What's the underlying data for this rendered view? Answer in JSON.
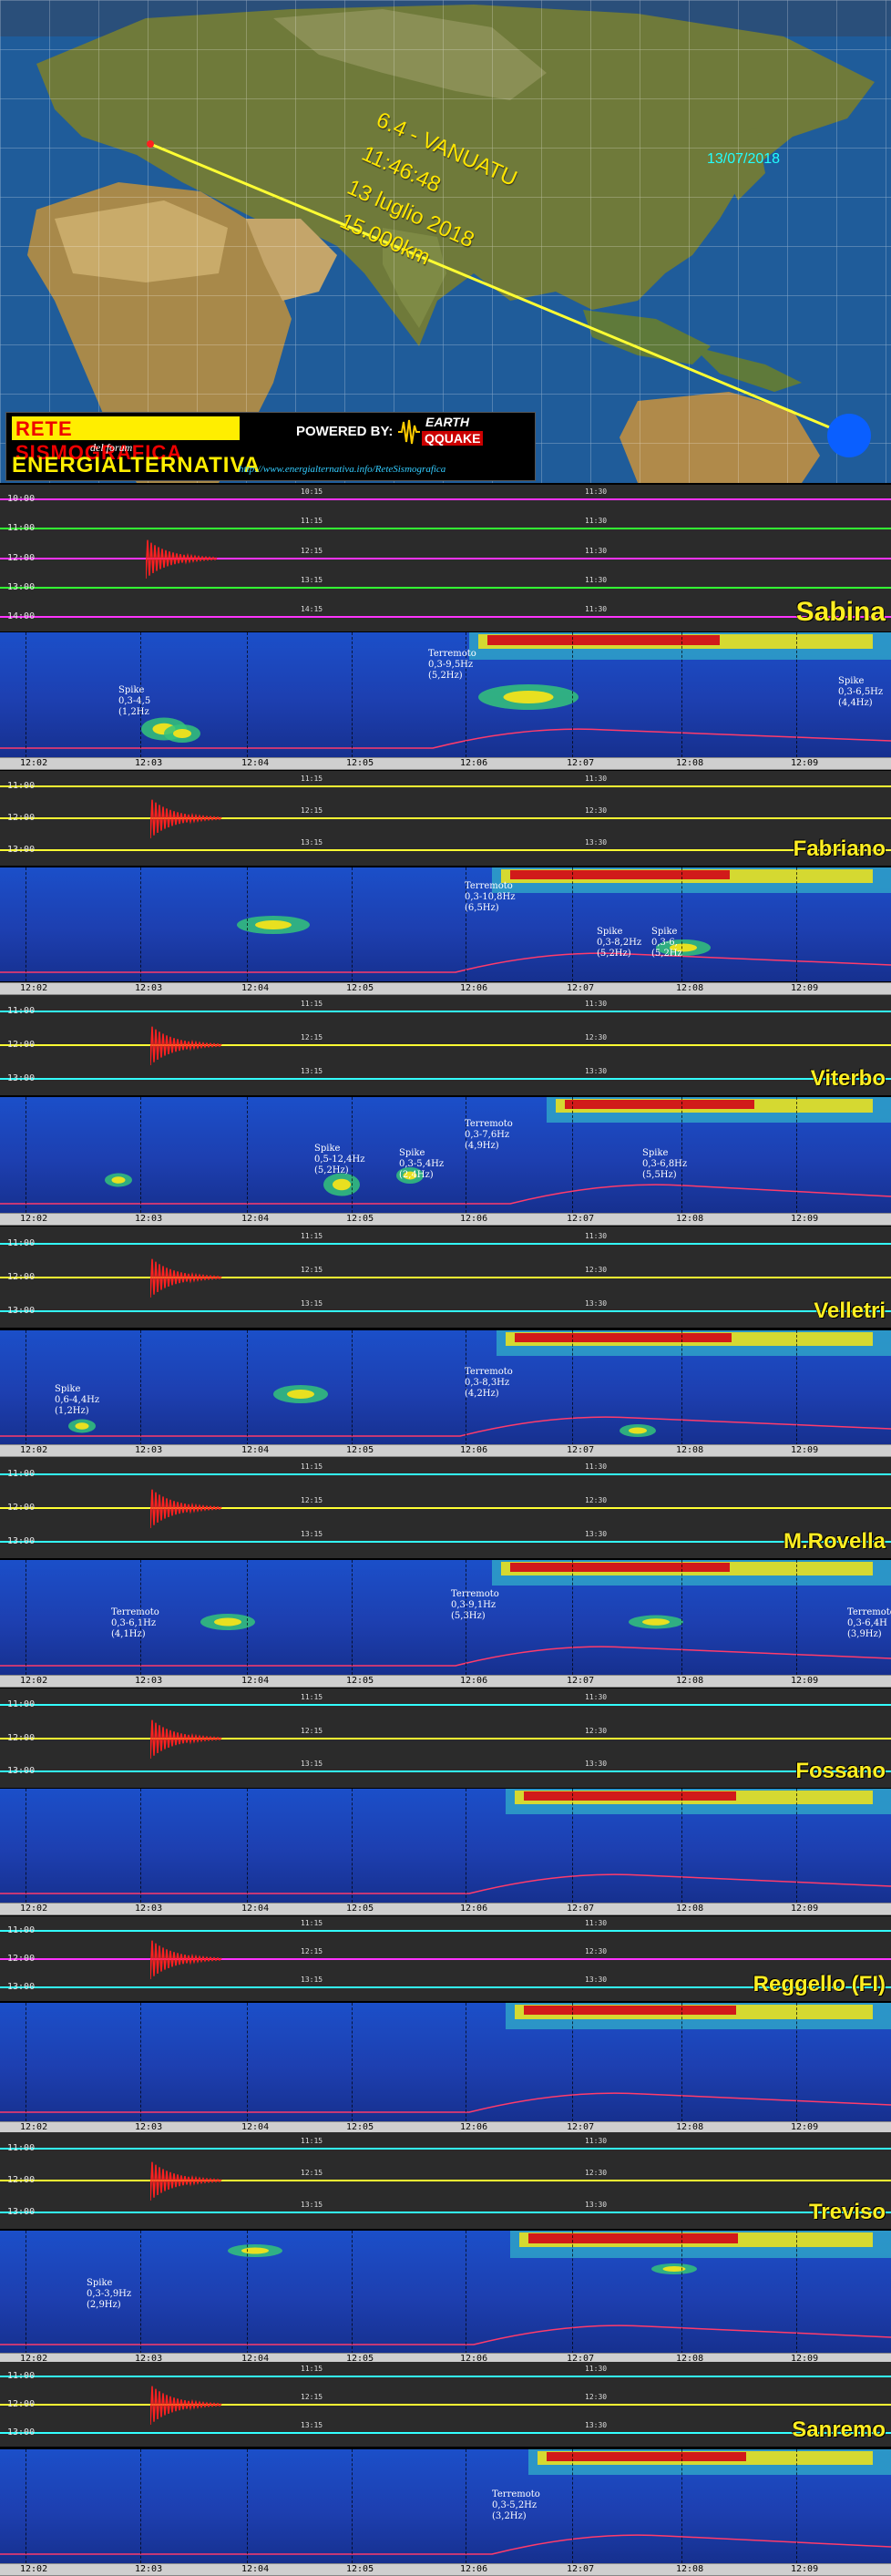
{
  "map": {
    "date": "13/07/2018",
    "event": {
      "magnitude_place": "6.4 - VANUATU",
      "time": "11:46:48",
      "date": "13 luglio 2018",
      "distance": "15.000km"
    },
    "colors": {
      "ocean": "#1f5c9a",
      "land": "#6f7a3a",
      "path": "#ffff33",
      "epicenter": "#0a5fff"
    },
    "icons": [
      "epicenter-marker-icon",
      "seismic-wave-icon"
    ]
  },
  "logo": {
    "title": "RETE SISMOGRAFICA",
    "forum": "del forum",
    "brand": "ENERGIALTERNATIVA",
    "powered_by": "POWERED BY:",
    "earth": "EARTH",
    "qquake": "QQUAKE",
    "url": "http://www.energialternativa.info/ReteSismografica"
  },
  "time_axis": [
    "12:02",
    "12:03",
    "12:04",
    "12:05",
    "12:06",
    "12:07",
    "12:08",
    "12:09"
  ],
  "stations": [
    {
      "name": "Sabina",
      "hours": [
        "10:00",
        "11:00",
        "12:00",
        "13:00",
        "14:00"
      ],
      "mids": [
        "10:15",
        "11:15",
        "12:15",
        "13:15",
        "14:15"
      ],
      "mids_r": [
        "11:30",
        "11:30",
        "11:30",
        "11:30",
        "11:30"
      ],
      "annotations": [
        {
          "lines": [
            "Spike",
            "0,3-4,5",
            "(1,2Hz"
          ]
        },
        {
          "lines": [
            "Terremoto",
            "0,3-9,5Hz",
            "(5,2Hz)"
          ]
        },
        {
          "lines": [
            "Spike",
            "0,3-6,5Hz",
            "(4,4Hz)"
          ]
        }
      ]
    },
    {
      "name": "Fabriano",
      "hours": [
        "11:00",
        "12:00",
        "13:00"
      ],
      "mids": [
        "11:15",
        "12:15",
        "13:15"
      ],
      "mids_r": [
        "11:30",
        "12:30",
        "13:30"
      ],
      "annotations": [
        {
          "lines": [
            "Terremoto",
            "0,3-10,8Hz",
            "(6,5Hz)"
          ]
        },
        {
          "lines": [
            "Spike",
            "0,3-8,2Hz",
            "(5,2Hz)"
          ]
        },
        {
          "lines": [
            "Spike",
            "0,3-6,",
            "(5,2Hz"
          ]
        }
      ]
    },
    {
      "name": "Viterbo",
      "hours": [
        "11:00",
        "12:00",
        "13:00"
      ],
      "mids": [
        "11:15",
        "12:15",
        "13:15"
      ],
      "mids_r": [
        "11:30",
        "12:30",
        "13:30"
      ],
      "annotations": [
        {
          "lines": [
            "Spike",
            "0,5-12,4Hz",
            "(5,2Hz)"
          ]
        },
        {
          "lines": [
            "Spike",
            "0,3-5,4Hz",
            "(2,4Hz)"
          ]
        },
        {
          "lines": [
            "Terremoto",
            "0,3-7,6Hz",
            "(4,9Hz)"
          ]
        },
        {
          "lines": [
            "Spike",
            "0,3-6,8Hz",
            "(5,5Hz)"
          ]
        }
      ]
    },
    {
      "name": "Velletri",
      "hours": [
        "11:00",
        "12:00",
        "13:00"
      ],
      "mids": [
        "11:15",
        "12:15",
        "13:15"
      ],
      "mids_r": [
        "11:30",
        "12:30",
        "13:30"
      ],
      "annotations": [
        {
          "lines": [
            "Spike",
            "0,6-4,4Hz",
            "(1,2Hz)"
          ]
        },
        {
          "lines": [
            "Terremoto",
            "0,3-8,3Hz",
            "(4,2Hz)"
          ]
        }
      ]
    },
    {
      "name": "M.Rovella",
      "hours": [
        "11:00",
        "12:00",
        "13:00"
      ],
      "mids": [
        "11:15",
        "12:15",
        "13:15"
      ],
      "mids_r": [
        "11:30",
        "12:30",
        "13:30"
      ],
      "annotations": [
        {
          "lines": [
            "Terremoto",
            "0,3-6,1Hz",
            "(4,1Hz)"
          ]
        },
        {
          "lines": [
            "Terremoto",
            "0,3-9,1Hz",
            "(5,3Hz)"
          ]
        },
        {
          "lines": [
            "Terremoto",
            "0,3-6,4H",
            "(3,9Hz)"
          ]
        }
      ]
    },
    {
      "name": "Fossano",
      "hours": [
        "11:00",
        "12:00",
        "13:00"
      ],
      "mids": [
        "11:15",
        "12:15",
        "13:15"
      ],
      "mids_r": [
        "11:30",
        "12:30",
        "13:30"
      ],
      "annotations": []
    },
    {
      "name": "Reggello (FI)",
      "hours": [
        "11:00",
        "12:00",
        "13:00"
      ],
      "mids": [
        "11:15",
        "12:15",
        "13:15"
      ],
      "mids_r": [
        "11:30",
        "12:30",
        "13:30"
      ],
      "annotations": []
    },
    {
      "name": "Treviso",
      "hours": [
        "11:00",
        "12:00",
        "13:00"
      ],
      "mids": [
        "11:15",
        "12:15",
        "13:15"
      ],
      "mids_r": [
        "11:30",
        "12:30",
        "13:30"
      ],
      "annotations": [
        {
          "lines": [
            "Spike",
            "0,3-3,9Hz",
            "(2,9Hz)"
          ]
        }
      ]
    },
    {
      "name": "Sanremo",
      "hours": [
        "11:00",
        "12:00",
        "13:00"
      ],
      "mids": [
        "11:15",
        "12:15",
        "13:15"
      ],
      "mids_r": [
        "11:30",
        "12:30",
        "13:30"
      ],
      "annotations": [
        {
          "lines": [
            "Terremoto",
            "0,3-5,2Hz",
            "(3,2Hz)"
          ]
        }
      ]
    }
  ]
}
